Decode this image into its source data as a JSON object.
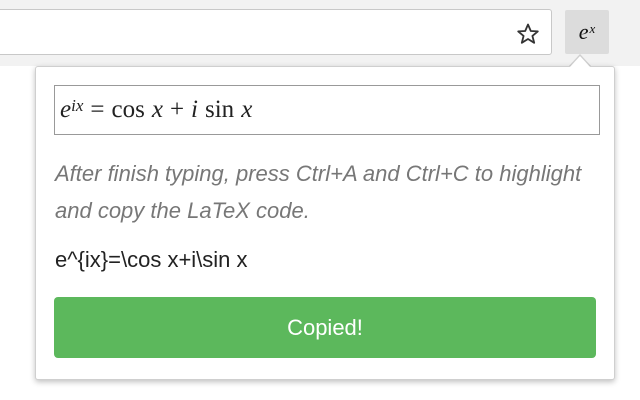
{
  "toolbar": {
    "star_icon": "star-outline-icon",
    "extension": {
      "base": "e",
      "exponent": "x"
    }
  },
  "popup": {
    "math": {
      "base": "e",
      "exponent": "ix",
      "equals": "=",
      "cos": "cos",
      "x1": "x",
      "plus": "+",
      "i": "i",
      "sin": "sin",
      "x2": "x"
    },
    "instructions": "After finish typing, press Ctrl+A and Ctrl+C to highlight and copy the LaTeX code.",
    "latex_code": "e^{ix}=\\cos x+i\\sin x",
    "copy_button_label": "Copied!"
  },
  "colors": {
    "button_green": "#5cb85c",
    "hint_gray": "#777777"
  }
}
